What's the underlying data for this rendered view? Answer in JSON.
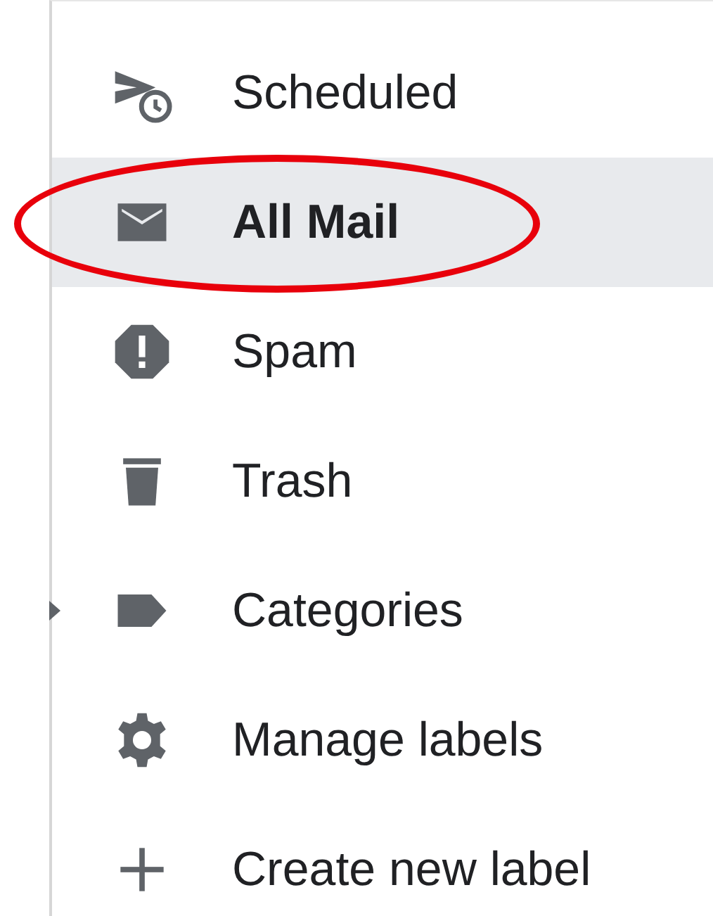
{
  "sidebar": {
    "items": [
      {
        "label": "Scheduled",
        "selected": false
      },
      {
        "label": "All Mail",
        "selected": true
      },
      {
        "label": "Spam",
        "selected": false
      },
      {
        "label": "Trash",
        "selected": false
      },
      {
        "label": "Categories",
        "selected": false,
        "expanded": false
      },
      {
        "label": "Manage labels",
        "selected": false
      },
      {
        "label": "Create new label",
        "selected": false
      }
    ]
  }
}
